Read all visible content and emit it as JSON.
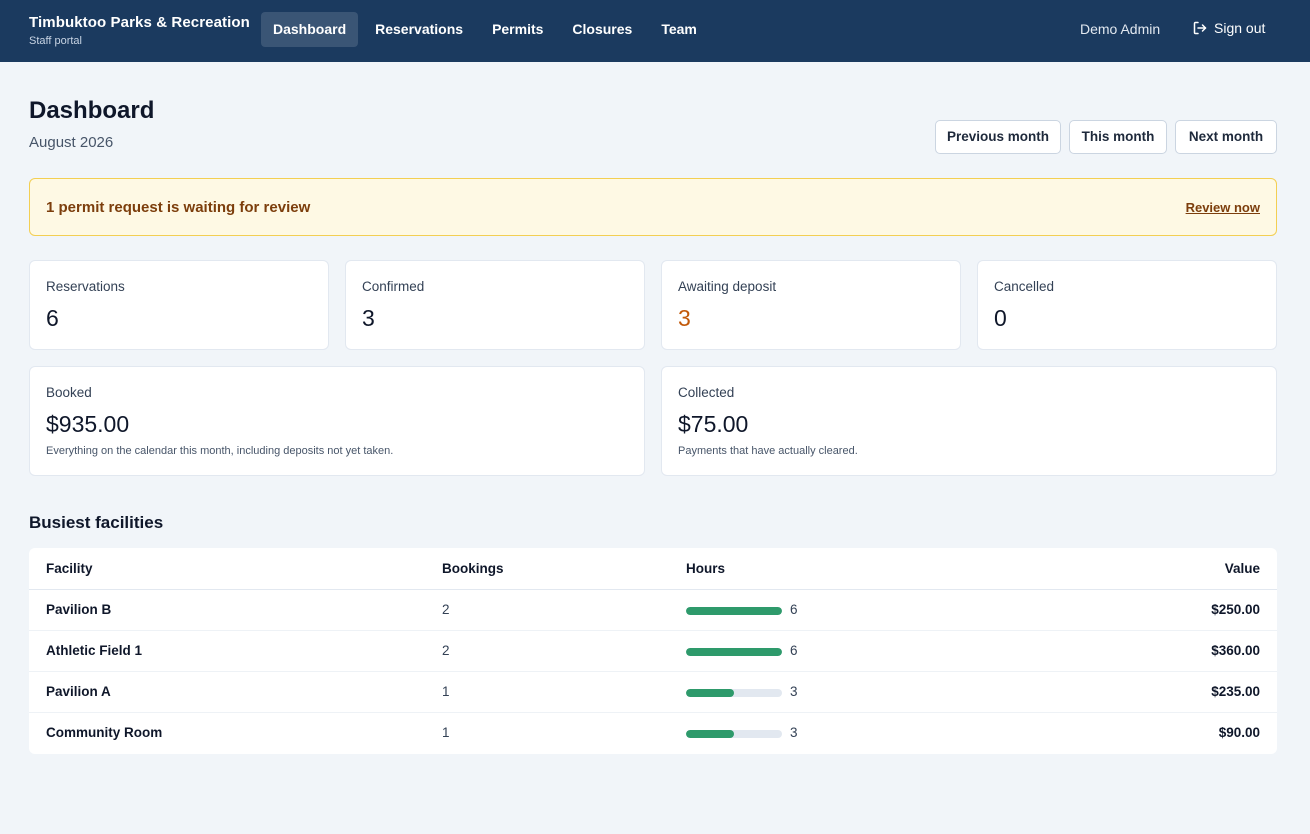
{
  "header": {
    "brand_title": "Timbuktoo Parks & Recreation",
    "brand_subtitle": "Staff portal",
    "nav": [
      {
        "label": "Dashboard",
        "active": true
      },
      {
        "label": "Reservations",
        "active": false
      },
      {
        "label": "Permits",
        "active": false
      },
      {
        "label": "Closures",
        "active": false
      },
      {
        "label": "Team",
        "active": false
      }
    ],
    "user_name": "Demo Admin",
    "signout_label": "Sign out",
    "signout_icon": "sign-out-icon"
  },
  "page": {
    "title": "Dashboard",
    "subtitle": "August 2026",
    "buttons": {
      "previous": "Previous month",
      "this": "This month",
      "next": "Next month"
    }
  },
  "alert": {
    "text": "1 permit request is waiting for review",
    "link": "Review now"
  },
  "stats": {
    "reservations": {
      "label": "Reservations",
      "value": "6"
    },
    "confirmed": {
      "label": "Confirmed",
      "value": "3"
    },
    "awaiting": {
      "label": "Awaiting deposit",
      "value": "3"
    },
    "cancelled": {
      "label": "Cancelled",
      "value": "0"
    },
    "booked": {
      "label": "Booked",
      "value": "$935.00",
      "note": "Everything on the calendar this month, including deposits not yet taken."
    },
    "collected": {
      "label": "Collected",
      "value": "$75.00",
      "note": "Payments that have actually cleared."
    }
  },
  "facilities": {
    "title": "Busiest facilities",
    "columns": {
      "facility": "Facility",
      "bookings": "Bookings",
      "hours": "Hours",
      "value": "Value"
    },
    "max_hours": 6,
    "rows": [
      {
        "facility": "Pavilion B",
        "bookings": "2",
        "hours": "6",
        "value": "$250.00"
      },
      {
        "facility": "Athletic Field 1",
        "bookings": "2",
        "hours": "6",
        "value": "$360.00"
      },
      {
        "facility": "Pavilion A",
        "bookings": "1",
        "hours": "3",
        "value": "$235.00"
      },
      {
        "facility": "Community Room",
        "bookings": "1",
        "hours": "3",
        "value": "$90.00"
      }
    ]
  },
  "colors": {
    "header_bg": "#1b3a5f",
    "accent_green": "#2e9a6b",
    "warn_orange": "#c2590a",
    "alert_bg": "#fef9e4",
    "alert_border": "#f3cf53"
  }
}
